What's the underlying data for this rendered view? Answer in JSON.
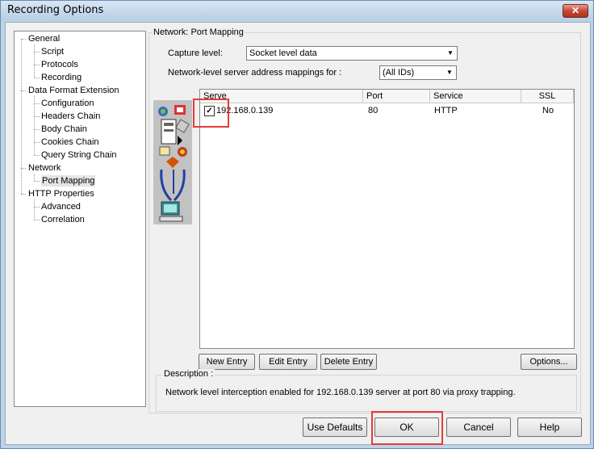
{
  "window": {
    "title": "Recording Options",
    "close_label": "✕"
  },
  "tree": {
    "items": [
      {
        "label": "General",
        "level": 0
      },
      {
        "label": "Script",
        "level": 1
      },
      {
        "label": "Protocols",
        "level": 1
      },
      {
        "label": "Recording",
        "level": 1
      },
      {
        "label": "Data Format Extension",
        "level": 0
      },
      {
        "label": "Configuration",
        "level": 1
      },
      {
        "label": "Headers Chain",
        "level": 1
      },
      {
        "label": "Body Chain",
        "level": 1
      },
      {
        "label": "Cookies Chain",
        "level": 1
      },
      {
        "label": "Query String Chain",
        "level": 1
      },
      {
        "label": "Network",
        "level": 0
      },
      {
        "label": "Port Mapping",
        "level": 1,
        "selected": true
      },
      {
        "label": "HTTP Properties",
        "level": 0
      },
      {
        "label": "Advanced",
        "level": 1
      },
      {
        "label": "Correlation",
        "level": 1
      }
    ]
  },
  "panel": {
    "group_title": "Network: Port Mapping",
    "capture_label": "Capture level:",
    "capture_value": "Socket level data",
    "mapping_label": "Network-level server address mappings for :",
    "mapping_value": "(All IDs)"
  },
  "table": {
    "columns": [
      "Serve",
      "Port",
      "Service",
      "SSL"
    ],
    "rows": [
      {
        "checked": true,
        "server": "192.168.0.139",
        "port": "80",
        "service": "HTTP",
        "ssl": "No"
      }
    ]
  },
  "buttons": {
    "new_entry": "New Entry",
    "edit_entry": "Edit Entry",
    "delete_entry": "Delete Entry",
    "options": "Options...",
    "use_defaults": "Use Defaults",
    "ok": "OK",
    "cancel": "Cancel",
    "help": "Help"
  },
  "description": {
    "title": "Description :",
    "text": "Network level interception enabled for 192.168.0.139 server at port 80 via proxy trapping."
  },
  "colors": {
    "highlight_box": "#e43c3c",
    "title_bar": "#bcd3ea",
    "close_button": "#c4422f"
  }
}
